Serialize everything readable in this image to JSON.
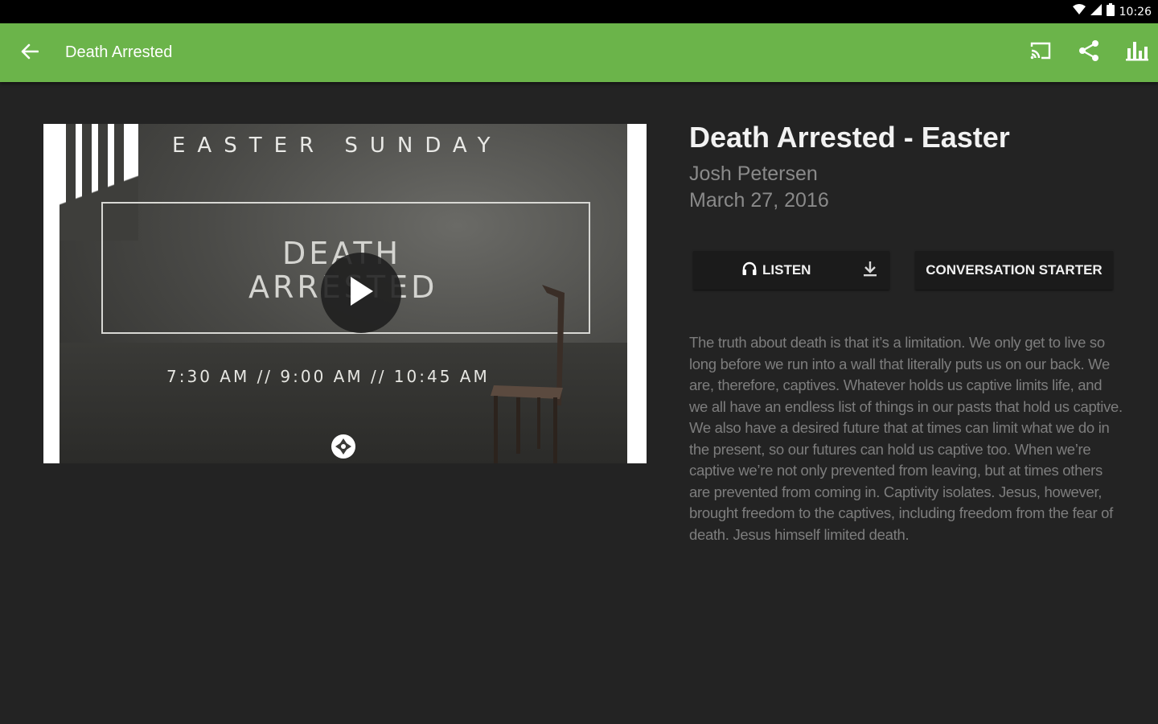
{
  "status_bar": {
    "time": "10:26"
  },
  "toolbar": {
    "title": "Death Arrested",
    "back_icon": "arrow-left-icon",
    "actions": [
      "cast-icon",
      "share-icon",
      "stats-icon"
    ]
  },
  "media": {
    "eyebrow": "EASTER SUNDAY",
    "series_line1": "DEATH",
    "series_line2": "ARRESTED",
    "service_times": "7:30 AM // 9:00 AM // 10:45 AM"
  },
  "sermon": {
    "title": "Death Arrested - Easter",
    "speaker": "Josh Petersen",
    "date": "March 27, 2016",
    "listen_label": "LISTEN",
    "conversation_label": "CONVERSATION STARTER",
    "description": "The truth about death is that it’s a limitation. We only get to live so long before we run into a wall that literally puts us on our back. We are, therefore, captives. Whatever holds us captive limits life, and we all have an endless list of things in our pasts that hold us captive. We also have a desired future that at times can limit what we do in the present, so our futures can hold us captive too. When we’re captive we’re not only prevented from leaving, but at times others are prevented from coming in. Captivity isolates. Jesus, however, brought freedom to the captives, including freedom from the fear of death. Jesus himself limited death."
  },
  "colors": {
    "toolbar": "#6bb44a",
    "background": "#232323",
    "button": "#1b1b1b",
    "secondary_text": "#8a8a8a"
  }
}
